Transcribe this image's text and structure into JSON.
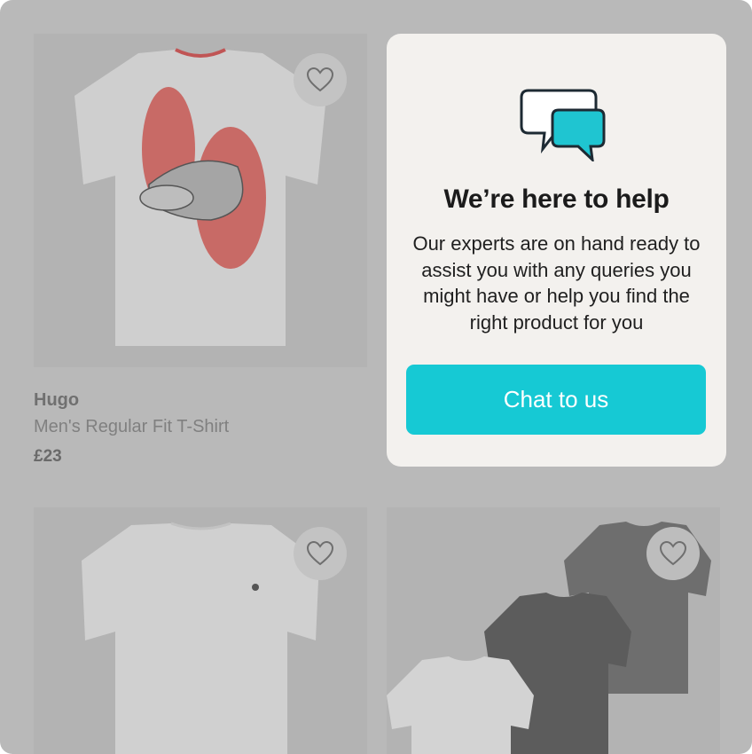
{
  "products": [
    {
      "brand": "Hugo",
      "name": "Men's Regular Fit T-Shirt",
      "price": "£23",
      "favourite_icon": "heart-outline-icon"
    },
    {
      "favourite_icon": "heart-outline-icon"
    },
    {
      "favourite_icon": "heart-outline-icon"
    }
  ],
  "help_card": {
    "icon": "chat-bubbles-icon",
    "title": "We’re here to help",
    "body": "Our experts are on hand ready to assist you with any queries you might have or help you find the right product for you",
    "button_label": "Chat to us"
  },
  "colors": {
    "accent": "#16c9d4",
    "card_background": "#f3f1ee",
    "overlay": "#b9b9b9"
  }
}
